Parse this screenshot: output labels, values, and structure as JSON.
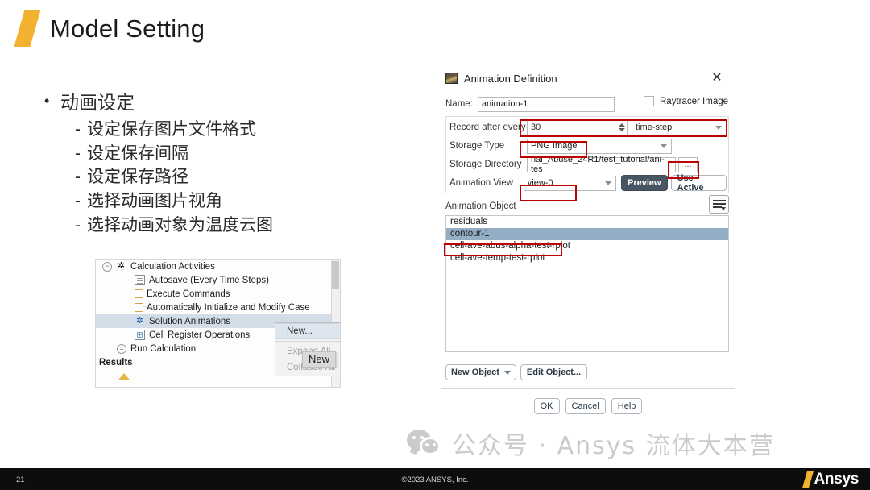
{
  "slide": {
    "title": "Model Setting",
    "page_number": "21",
    "copyright": "©2023 ANSYS, Inc.",
    "brand": "Ansys",
    "accent_color": "#f2b230",
    "annotation_color": "#c00000"
  },
  "bullets": {
    "level1": "动画设定",
    "level2": [
      "设定保存图片文件格式",
      "设定保存间隔",
      "设定保存路径",
      "选择动画图片视角",
      "选择动画对象为温度云图"
    ]
  },
  "tree_panel": {
    "items": [
      {
        "label": "Calculation Activities",
        "icon": "gear-icon",
        "twisty": "−",
        "selected": false
      },
      {
        "label": "Autosave (Every Time Steps)",
        "icon": "document-icon",
        "twisty": "",
        "selected": false
      },
      {
        "label": "Execute Commands",
        "icon": "execute-icon",
        "twisty": "",
        "selected": false
      },
      {
        "label": "Automatically Initialize and Modify Case",
        "icon": "execute-icon",
        "twisty": "",
        "selected": false
      },
      {
        "label": "Solution Animations",
        "icon": "gear-blue-icon",
        "twisty": "",
        "selected": true
      },
      {
        "label": "Cell Register Operations",
        "icon": "grid-icon",
        "twisty": "",
        "selected": false
      },
      {
        "label": "Run Calculation",
        "icon": "equals-icon",
        "twisty": "=",
        "selected": false
      },
      {
        "label": "Results",
        "icon": "",
        "twisty": "",
        "selected": false
      }
    ],
    "context_menu": {
      "items": [
        {
          "label": "New...",
          "enabled": true,
          "highlighted": true
        },
        {
          "label": "Expand All",
          "enabled": false,
          "highlighted": false
        },
        {
          "label": "Collapse All",
          "enabled": false,
          "highlighted": false
        }
      ],
      "tooltip": "New"
    }
  },
  "dialog": {
    "title": "Animation Definition",
    "close_label": "✕",
    "name_label": "Name:",
    "name_value": "animation-1",
    "raytracer_label": "Raytracer Image",
    "raytracer_checked": false,
    "fields": {
      "record_label": "Record after every",
      "record_value": "30",
      "record_unit": "time-step",
      "storage_type_label": "Storage Type",
      "storage_type_value": "PNG Image",
      "storage_dir_label": "Storage Directory",
      "storage_dir_value": "nal_Abuse_24R1/test_tutorial/ani-tes",
      "browse_label": "...",
      "animation_view_label": "Animation View",
      "animation_view_value": "view-0",
      "preview_label": "Preview",
      "use_active_label": "Use Active"
    },
    "animation_object": {
      "label": "Animation Object",
      "items": [
        {
          "name": "residuals",
          "selected": false
        },
        {
          "name": "contour-1",
          "selected": true
        },
        {
          "name": "cell-ave-abus-alpha-test-rplot",
          "selected": false
        },
        {
          "name": "cell-ave-temp-test-rplot",
          "selected": false
        }
      ],
      "new_object_label": "New Object",
      "edit_object_label": "Edit Object..."
    },
    "footer": {
      "ok_label": "OK",
      "cancel_label": "Cancel",
      "help_label": "Help"
    }
  },
  "watermark": {
    "text": "公众号 · Ansys 流体大本营"
  }
}
